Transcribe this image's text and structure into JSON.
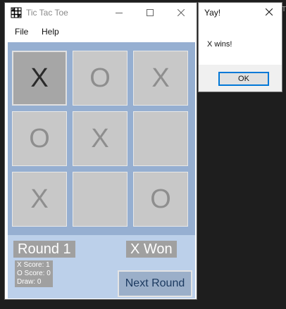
{
  "window": {
    "title": "Tic Tac Toe",
    "icon": "grid-icon",
    "controls": [
      "minimize-icon",
      "maximize-icon",
      "close-icon"
    ]
  },
  "menu": [
    "File",
    "Help"
  ],
  "board": {
    "cells": [
      "X",
      "O",
      "X",
      "O",
      "X",
      "",
      "X",
      "",
      "O"
    ],
    "selected_cell": 0
  },
  "status": {
    "round": "Round 1",
    "result": "X Won",
    "x_score": "X Score: 1",
    "o_score": "O Score: 0",
    "draw": "Draw: 0",
    "next_button": "Next Round"
  },
  "dialog": {
    "title": "Yay!",
    "message": "X wins!",
    "ok": "OK"
  },
  "edge_fragment": "T",
  "colors": {
    "board_bg": "#96afd1",
    "cell_bg": "#c8c8c8",
    "selected_cell_bg": "#a6a6a6",
    "panel_bg": "#bcd0ea",
    "label_bg": "#a0a0a0",
    "next_button_bg": "#9bafc9",
    "ok_border": "#0078d7"
  }
}
